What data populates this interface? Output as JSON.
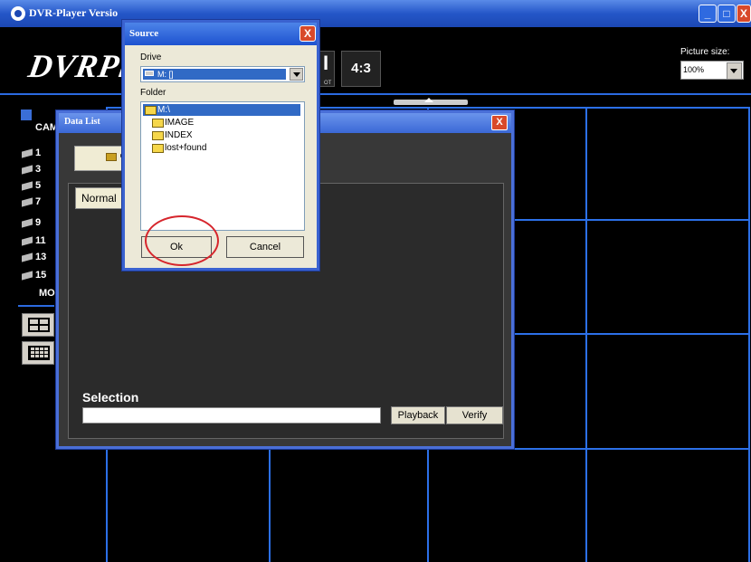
{
  "main_window": {
    "title": "DVR-Player Versio",
    "min_glyph": "_",
    "max_glyph": "□",
    "close_glyph": "X"
  },
  "toolbar": {
    "logo": "DVRPl",
    "snapshot_glyph": "I",
    "snapshot_caption": "OT",
    "aspect_button": "4:3",
    "picture_size_label": "Picture size:",
    "picture_size_value": "100%"
  },
  "left_panel": {
    "camera_label": "CAM",
    "cameras": [
      "1",
      "3",
      "5",
      "7",
      "9",
      "11",
      "13",
      "15"
    ],
    "mode_label": "MO"
  },
  "data_list": {
    "title": "Data List",
    "close_glyph": "X",
    "tab_normal": "Normal",
    "selection_label": "Selection",
    "selection_value": "",
    "playback_button": "Playback",
    "verify_button": "Verify"
  },
  "source_dialog": {
    "title": "Source",
    "close_glyph": "X",
    "drive_label": "Drive",
    "drive_value": "M: []",
    "folder_label": "Folder",
    "folders": [
      "M:\\",
      "IMAGE",
      "INDEX",
      "lost+found"
    ],
    "ok_button": "Ok",
    "cancel_button": "Cancel"
  },
  "colors": {
    "grid_lines": "#2c70e8",
    "highlight_circle": "#d6252c",
    "title_bar": "#2456c8"
  }
}
